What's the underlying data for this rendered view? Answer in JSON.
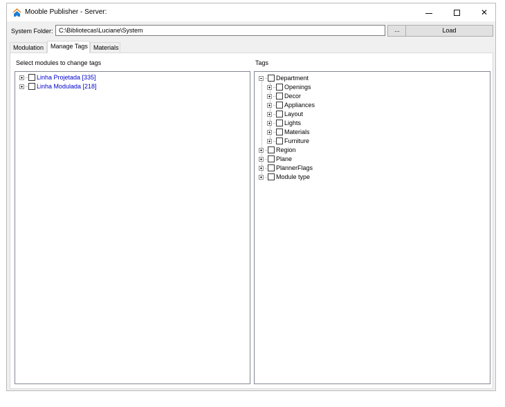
{
  "window": {
    "title": "Mooble Publisher - Server:",
    "controls": {
      "minimize": "minimize",
      "maximize": "maximize",
      "close": "✕"
    }
  },
  "toolbar": {
    "folder_label": "System Folder:",
    "folder_value": "C:\\Bibliotecas\\Luciane\\System",
    "browse_label": "...",
    "load_label": "Load"
  },
  "tabs": [
    {
      "label": "Modulation"
    },
    {
      "label": "Manage Tags"
    },
    {
      "label": "Materials"
    }
  ],
  "active_tab": "Manage Tags",
  "left_pane": {
    "label": "Select modules to change tags",
    "items": [
      {
        "label": "Linha Projetada [335]"
      },
      {
        "label": "Linha Modulada [218]"
      }
    ]
  },
  "right_pane": {
    "label": "Tags",
    "root": {
      "label": "Department",
      "children": [
        {
          "label": "Openings"
        },
        {
          "label": "Decor"
        },
        {
          "label": "Appliances"
        },
        {
          "label": "Layout"
        },
        {
          "label": "Lights"
        },
        {
          "label": "Materials"
        },
        {
          "label": "Furniture"
        }
      ]
    },
    "others": [
      {
        "label": "Region"
      },
      {
        "label": "Plane"
      },
      {
        "label": "PlannerFlags"
      },
      {
        "label": "Module type"
      }
    ]
  },
  "colors": {
    "module_text": "#0000cc",
    "window_bg": "#f0f0f0",
    "icon_orange": "#e8821e",
    "icon_blue": "#1e7fd0"
  }
}
